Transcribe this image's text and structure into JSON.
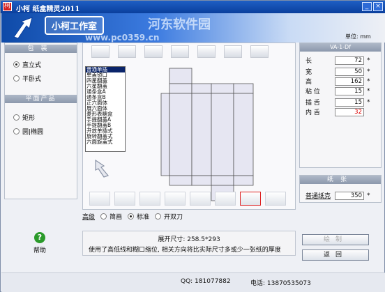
{
  "window": {
    "title": "小柯 纸盒精灵2011",
    "app_name": "小柯工作室",
    "title_icon": "app-logo-icon"
  },
  "watermark": {
    "line1": "河东软件园",
    "line2": "www.pc0359.cn"
  },
  "unit_label": "单位: mm",
  "packaging": {
    "header": "包装",
    "options": [
      {
        "label": "直立式",
        "selected": true
      },
      {
        "label": "平卧式",
        "selected": false
      }
    ]
  },
  "flat_product": {
    "header": "平面产品",
    "options": [
      {
        "label": "矩形",
        "selected": false
      },
      {
        "label": "圆|椭圆",
        "selected": false
      }
    ]
  },
  "box_types": [
    "普通单插",
    "单盖锁口",
    "四星翻盖",
    "六星翻盖",
    "通条盒A",
    "通条盒B",
    "正六面体",
    "展六面体",
    "菱形表糖盒",
    "手提翻盖A",
    "手提翻盖B",
    "开放单插式",
    "旋转翻盖式",
    "六面旋盖式"
  ],
  "selected_box_type_index": 0,
  "spec": {
    "code": "VA-1-Df",
    "fields": [
      {
        "label": "长",
        "value": "72",
        "star": "*",
        "red": false
      },
      {
        "label": "宽",
        "value": "50",
        "star": "*",
        "red": false
      },
      {
        "label": "高",
        "value": "162",
        "star": "*",
        "red": false
      },
      {
        "label": "粘 位",
        "value": "15",
        "star": "*",
        "red": false
      },
      {
        "label": "插 舌",
        "value": "15",
        "star": "*",
        "red": false
      },
      {
        "label": "内 舌",
        "value": "32",
        "star": "",
        "red": true
      }
    ]
  },
  "paper": {
    "header": "纸张",
    "label": "普通纸克",
    "value": "350",
    "star": "*"
  },
  "level": {
    "label": "高级",
    "options": [
      {
        "label": "简画",
        "selected": false
      },
      {
        "label": "标准",
        "selected": true
      },
      {
        "label": "开双刀",
        "selected": false
      }
    ]
  },
  "info": {
    "unfold_size": "展开尺寸: 258.5*293",
    "note": "使用了高低线和糊口缩位, 相关方向将比实际尺寸多或少一张纸的厚度"
  },
  "help_label": "帮助",
  "buttons": {
    "draw": "绘制",
    "back": "返回"
  },
  "footer": {
    "qq": "QQ: 181077882",
    "tel": "电话: 13870535073"
  },
  "colors": {
    "titlebar": "#0a3f9d",
    "selected_thumb_border": "#dd2222",
    "dieline_fill": "#e6e6f2"
  }
}
